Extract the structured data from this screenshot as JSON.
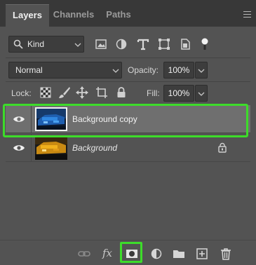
{
  "tabs": [
    {
      "label": "Layers",
      "active": true
    },
    {
      "label": "Channels",
      "active": false
    },
    {
      "label": "Paths",
      "active": false
    }
  ],
  "filter": {
    "kind_label": "Kind",
    "icons": [
      "pixel-layer-filter-icon",
      "adjustment-layer-filter-icon",
      "type-layer-filter-icon",
      "shape-layer-filter-icon",
      "smart-object-filter-icon",
      "filter-toggle-icon"
    ]
  },
  "blend": {
    "mode": "Normal",
    "opacity_label": "Opacity:",
    "opacity_value": "100%"
  },
  "lock": {
    "label": "Lock:",
    "icons": [
      "lock-transparent-pixels-icon",
      "lock-image-pixels-icon",
      "lock-position-icon",
      "lock-artboard-icon",
      "lock-all-icon"
    ],
    "fill_label": "Fill:",
    "fill_value": "100%"
  },
  "layers": [
    {
      "name": "Background copy",
      "selected": true,
      "visible": true,
      "locked": false,
      "italic": false
    },
    {
      "name": "Background",
      "selected": false,
      "visible": true,
      "locked": true,
      "italic": true
    }
  ],
  "bottom_toolbar": {
    "fx_label": "fx",
    "icons": [
      "link-layers-icon",
      "layer-style-icon",
      "add-mask-icon",
      "adjustment-layer-icon",
      "new-group-icon",
      "new-layer-icon",
      "delete-layer-icon"
    ]
  },
  "colors": {
    "panel_bg": "#535353",
    "selected_row": "#6f6f6f",
    "highlight": "#3ddc2a"
  }
}
